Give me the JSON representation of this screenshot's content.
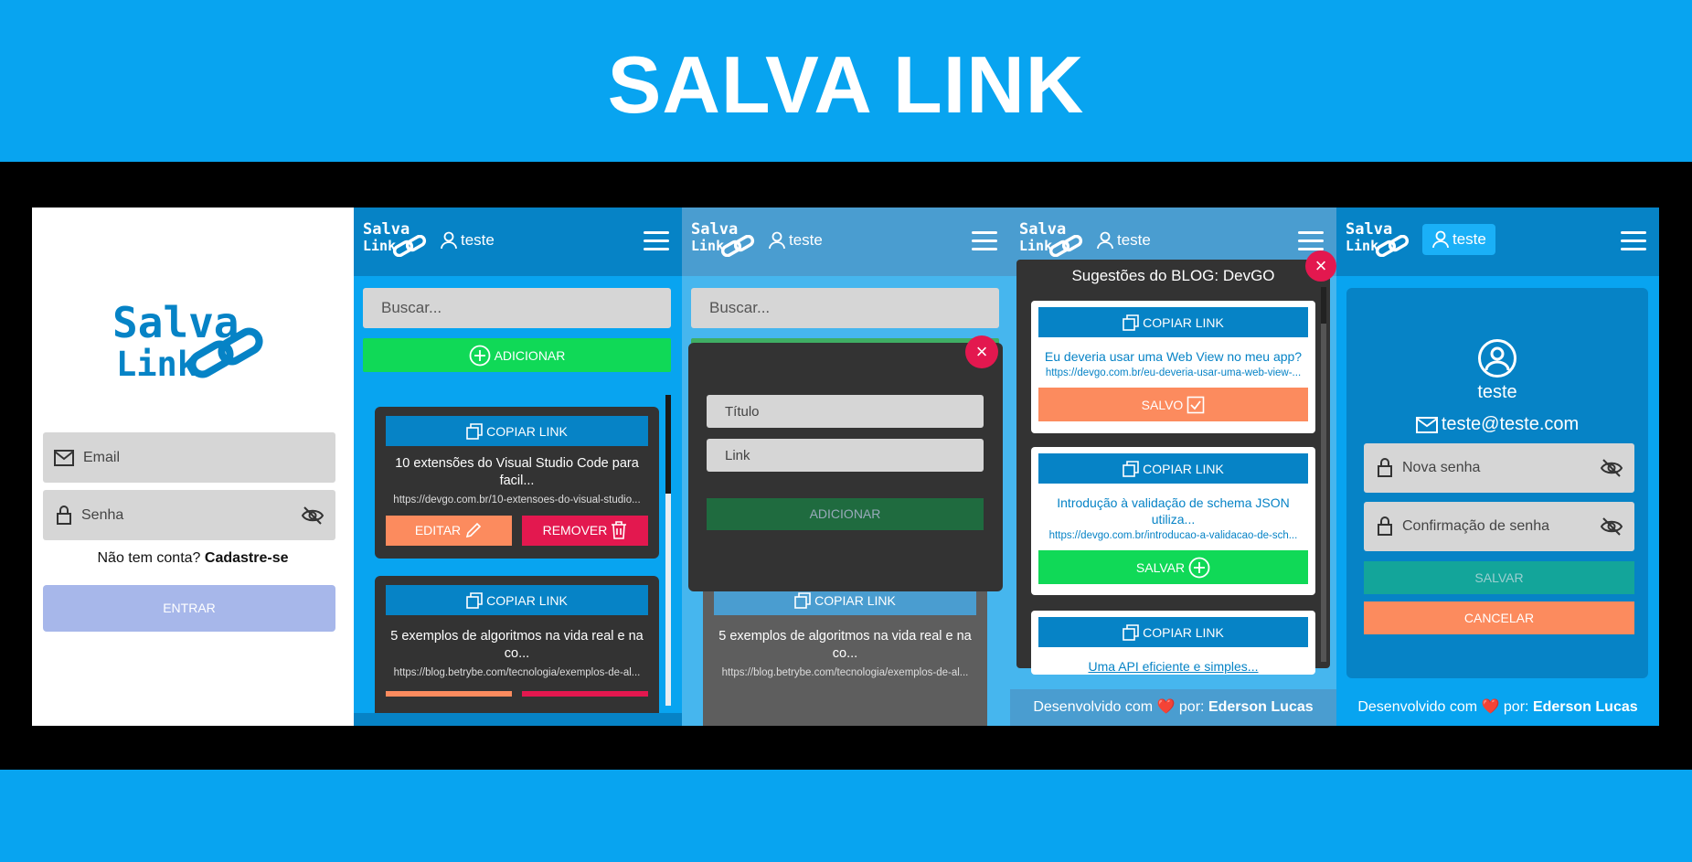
{
  "hero": {
    "title": "SALVA LINK"
  },
  "colors": {
    "primary": "#0683c6",
    "brand_blue": "#08a4f0",
    "green": "#10d957",
    "orange": "#fc8b5e",
    "red": "#e3184f",
    "dark_card": "#333333"
  },
  "logo": {
    "line1": "Salva",
    "line2": "Link"
  },
  "login": {
    "email_placeholder": "Email",
    "password_placeholder": "Senha",
    "no_account": "Não tem conta?",
    "signup_link": "Cadastre-se",
    "enter_button": "ENTRAR"
  },
  "topbar": {
    "username": "teste"
  },
  "list": {
    "search_placeholder": "Buscar...",
    "add_button": "ADICIONAR",
    "copy_label": "COPIAR LINK",
    "edit_label": "EDITAR",
    "remove_label": "REMOVER",
    "items": [
      {
        "title": "10 extensões do Visual Studio Code para facil...",
        "url": "https://devgo.com.br/10-extensoes-do-visual-studio..."
      },
      {
        "title": "5 exemplos de algoritmos na vida real e na co...",
        "url": "https://blog.betrybe.com/tecnologia/exemplos-de-al..."
      }
    ]
  },
  "add_modal": {
    "title_placeholder": "Título",
    "link_placeholder": "Link",
    "submit_button": "ADICIONAR",
    "close_icon": "×"
  },
  "suggestions": {
    "heading": "Sugestões do BLOG: DevGO",
    "saved_label": "SALVO",
    "save_label": "SALVAR",
    "items": [
      {
        "title": "Eu deveria usar uma Web View no meu app?",
        "url": "https://devgo.com.br/eu-deveria-usar-uma-web-view-...",
        "status": "SALVO"
      },
      {
        "title": "Introdução à validação de schema JSON utiliza...",
        "url": "https://devgo.com.br/introducao-a-validacao-de-sch...",
        "status": "SALVAR"
      },
      {
        "title": "Uma API eficiente e simples...",
        "url": ""
      }
    ]
  },
  "profile": {
    "username": "teste",
    "email": "teste@teste.com",
    "new_password_placeholder": "Nova senha",
    "confirm_password_placeholder": "Confirmação de senha",
    "save_button": "SALVAR",
    "cancel_button": "CANCELAR"
  },
  "footer": {
    "prefix": "Desenvolvido com",
    "heart": "❤️",
    "by": "por:",
    "author": "Ederson Lucas"
  }
}
